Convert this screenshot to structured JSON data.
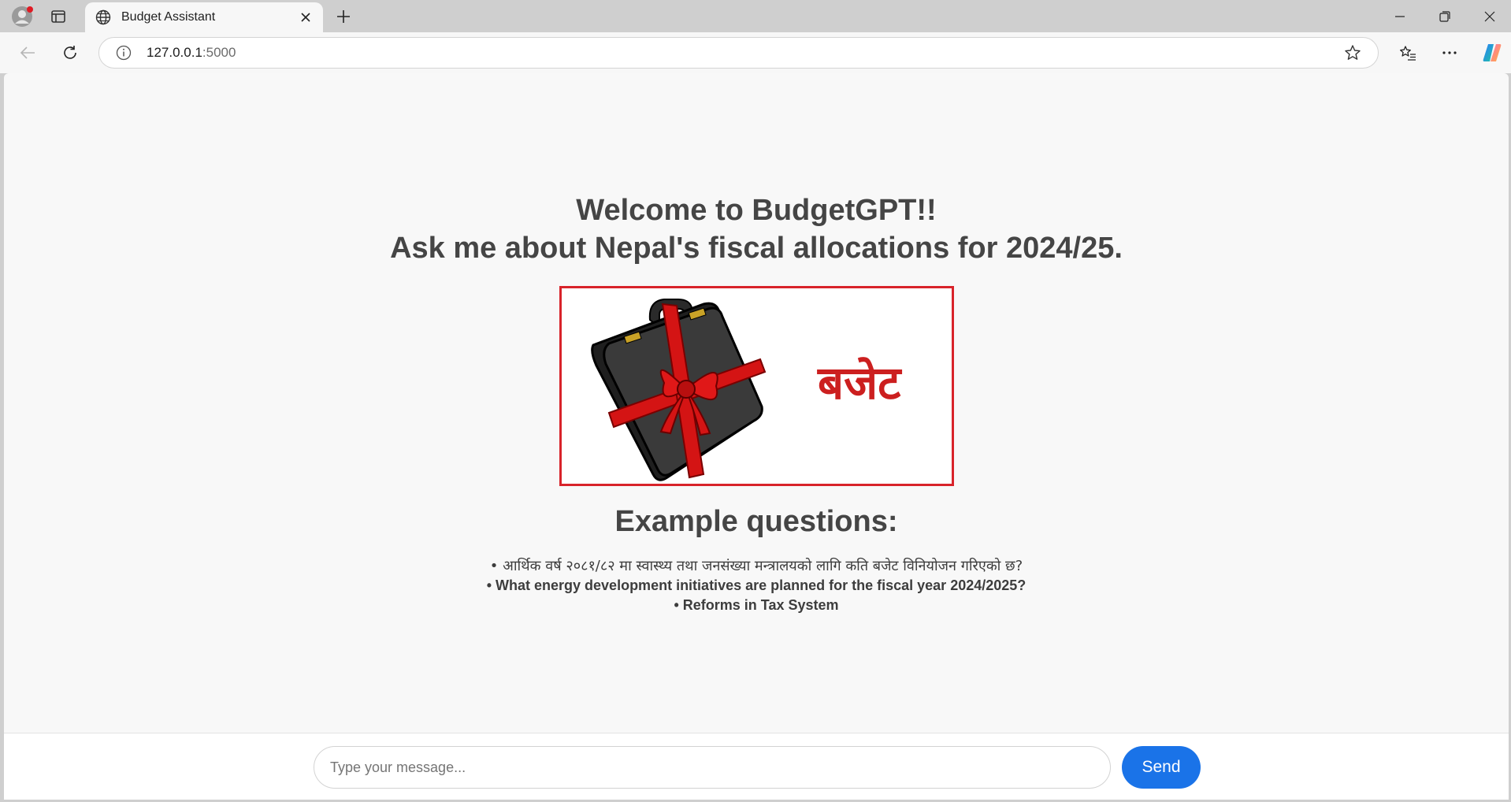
{
  "browser": {
    "tab_title": "Budget Assistant",
    "url_host": "127.0.0.1",
    "url_port": ":5000",
    "icons": [
      "profile-icon",
      "tab-actions-icon",
      "globe-icon",
      "close-icon",
      "plus-icon",
      "minimize-icon",
      "restore-icon",
      "window-close-icon",
      "back-icon",
      "refresh-icon",
      "info-icon",
      "star-icon",
      "favorites-icon",
      "more-icon",
      "copilot-icon"
    ]
  },
  "page": {
    "welcome_line1": "Welcome to BudgetGPT!!",
    "welcome_line2": "Ask me about Nepal's fiscal allocations for 2024/25.",
    "banner_text": "बजेट",
    "examples_title": "Example questions:",
    "examples": [
      "• आर्थिक वर्ष २०८१/८२ मा स्वास्थ्य तथा जनसंख्या मन्त्रालयको लागि कति बजेट विनियोजन गरिएको छ?",
      "• What energy development initiatives are planned for the fiscal year 2024/2025?",
      "• Reforms in Tax System"
    ]
  },
  "chat": {
    "placeholder": "Type your message...",
    "send_label": "Send"
  },
  "colors": {
    "accent": "#1a73e8",
    "banner_red": "#d8232a",
    "heading": "#454545"
  }
}
